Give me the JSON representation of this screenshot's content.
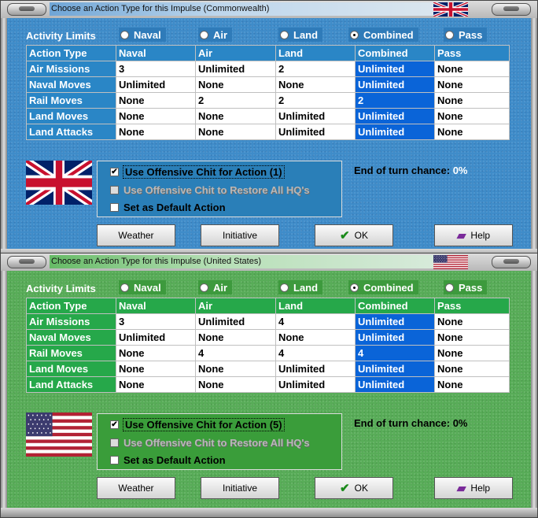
{
  "dialogs": [
    {
      "title": "Choose an Action Type for this Impulse (Commonwealth)",
      "activity_limits_label": "Activity Limits",
      "radio_options": [
        "Naval",
        "Air",
        "Land",
        "Combined",
        "Pass"
      ],
      "selected_radio": "Combined",
      "table": {
        "headers": [
          "Action Type",
          "Naval",
          "Air",
          "Land",
          "Combined",
          "Pass"
        ],
        "rows": [
          [
            "Air Missions",
            "3",
            "Unlimited",
            "2",
            "Unlimited",
            "None"
          ],
          [
            "Naval Moves",
            "Unlimited",
            "None",
            "None",
            "Unlimited",
            "None"
          ],
          [
            "Rail Moves",
            "None",
            "2",
            "2",
            "2",
            "None"
          ],
          [
            "Land Moves",
            "None",
            "None",
            "Unlimited",
            "Unlimited",
            "None"
          ],
          [
            "Land Attacks",
            "None",
            "None",
            "Unlimited",
            "Unlimited",
            "None"
          ]
        ]
      },
      "options": {
        "use_chit": "Use Offensive Chit for Action (1)",
        "use_chit_checked": true,
        "restore_hq": "Use Offensive Chit to Restore All HQ's",
        "restore_hq_checked": false,
        "default_action": "Set as Default Action",
        "default_action_checked": false
      },
      "end_of_turn_label": "End of turn chance:",
      "end_of_turn_value": "0%",
      "buttons": {
        "weather": "Weather",
        "initiative": "Initiative",
        "ok": "OK",
        "help": "Help"
      }
    },
    {
      "title": "Choose an Action Type for this Impulse (United States)",
      "activity_limits_label": "Activity Limits",
      "radio_options": [
        "Naval",
        "Air",
        "Land",
        "Combined",
        "Pass"
      ],
      "selected_radio": "Combined",
      "table": {
        "headers": [
          "Action Type",
          "Naval",
          "Air",
          "Land",
          "Combined",
          "Pass"
        ],
        "rows": [
          [
            "Air Missions",
            "3",
            "Unlimited",
            "4",
            "Unlimited",
            "None"
          ],
          [
            "Naval Moves",
            "Unlimited",
            "None",
            "None",
            "Unlimited",
            "None"
          ],
          [
            "Rail Moves",
            "None",
            "4",
            "4",
            "4",
            "None"
          ],
          [
            "Land Moves",
            "None",
            "None",
            "Unlimited",
            "Unlimited",
            "None"
          ],
          [
            "Land Attacks",
            "None",
            "None",
            "Unlimited",
            "Unlimited",
            "None"
          ]
        ]
      },
      "options": {
        "use_chit": "Use Offensive Chit for Action (5)",
        "use_chit_checked": true,
        "restore_hq": "Use Offensive Chit to Restore All HQ's",
        "restore_hq_checked": false,
        "default_action": "Set as Default Action",
        "default_action_checked": false
      },
      "end_of_turn_label": "End of turn chance:",
      "end_of_turn_value": "0%",
      "buttons": {
        "weather": "Weather",
        "initiative": "Initiative",
        "ok": "OK",
        "help": "Help"
      }
    }
  ],
  "colors": {
    "commonwealth_bg": "#3f8cc9",
    "us_bg": "#58ac58",
    "combined_highlight": "#0a64d8",
    "uk_flag_blue": "#012169",
    "uk_flag_red": "#c8102e",
    "us_flag_blue": "#3c3b6e",
    "us_flag_red": "#b22234"
  },
  "icons": {
    "ok": "check-icon",
    "help": "book-icon"
  }
}
